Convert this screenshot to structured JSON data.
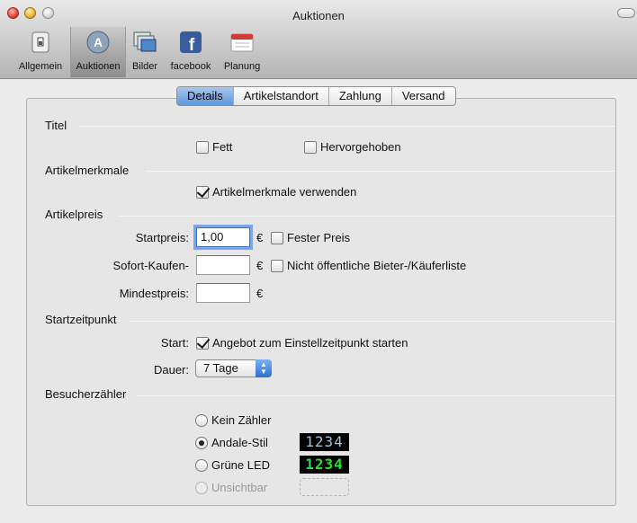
{
  "window": {
    "title": "Auktionen"
  },
  "toolbar": {
    "items": [
      {
        "label": "Allgemein",
        "icon": "switch-icon"
      },
      {
        "label": "Auktionen",
        "icon": "auction-icon",
        "selected": true
      },
      {
        "label": "Bilder",
        "icon": "photos-icon"
      },
      {
        "label": "facebook",
        "icon": "facebook-icon"
      },
      {
        "label": "Planung",
        "icon": "calendar-icon"
      }
    ]
  },
  "tabs": [
    {
      "label": "Details",
      "active": true
    },
    {
      "label": "Artikelstandort"
    },
    {
      "label": "Zahlung"
    },
    {
      "label": "Versand"
    }
  ],
  "titel": {
    "label": "Titel",
    "fett_label": "Fett",
    "fett_checked": false,
    "hervorgehoben_label": "Hervorgehoben",
    "hervorgehoben_checked": false
  },
  "artikelmerkmale": {
    "label": "Artikelmerkmale",
    "verwenden_label": "Artikelmerkmale verwenden",
    "verwenden_checked": true
  },
  "artikelpreis": {
    "label": "Artikelpreis",
    "startpreis_label": "Startpreis:",
    "startpreis_value": "1,00",
    "sofort_label": "Sofort-Kaufen-",
    "sofort_value": "",
    "mindest_label": "Mindestpreis:",
    "mindest_value": "",
    "currency": "€",
    "fester_preis_label": "Fester Preis",
    "fester_preis_checked": false,
    "nicht_oeffentlich_label": "Nicht öffentliche Bieter-/Käuferliste",
    "nicht_oeffentlich_checked": false
  },
  "startzeitpunkt": {
    "label": "Startzeitpunkt",
    "start_label": "Start:",
    "angebot_label": "Angebot zum Einstellzeitpunkt starten",
    "angebot_checked": true,
    "dauer_label": "Dauer:",
    "dauer_value": "7 Tage"
  },
  "besucherzaehler": {
    "label": "Besucherzähler",
    "options": [
      {
        "label": "Kein Zähler",
        "selected": false,
        "disabled": false,
        "preview": ""
      },
      {
        "label": "Andale-Stil",
        "selected": true,
        "disabled": false,
        "preview": "1234"
      },
      {
        "label": "Grüne LED",
        "selected": false,
        "disabled": false,
        "preview": "1234"
      },
      {
        "label": "Unsichtbar",
        "selected": false,
        "disabled": true,
        "preview": ""
      }
    ]
  },
  "colors": {
    "accent": "#5d96dc",
    "andale_digits": "#9fc3d6",
    "led_digits": "#27e12b"
  }
}
